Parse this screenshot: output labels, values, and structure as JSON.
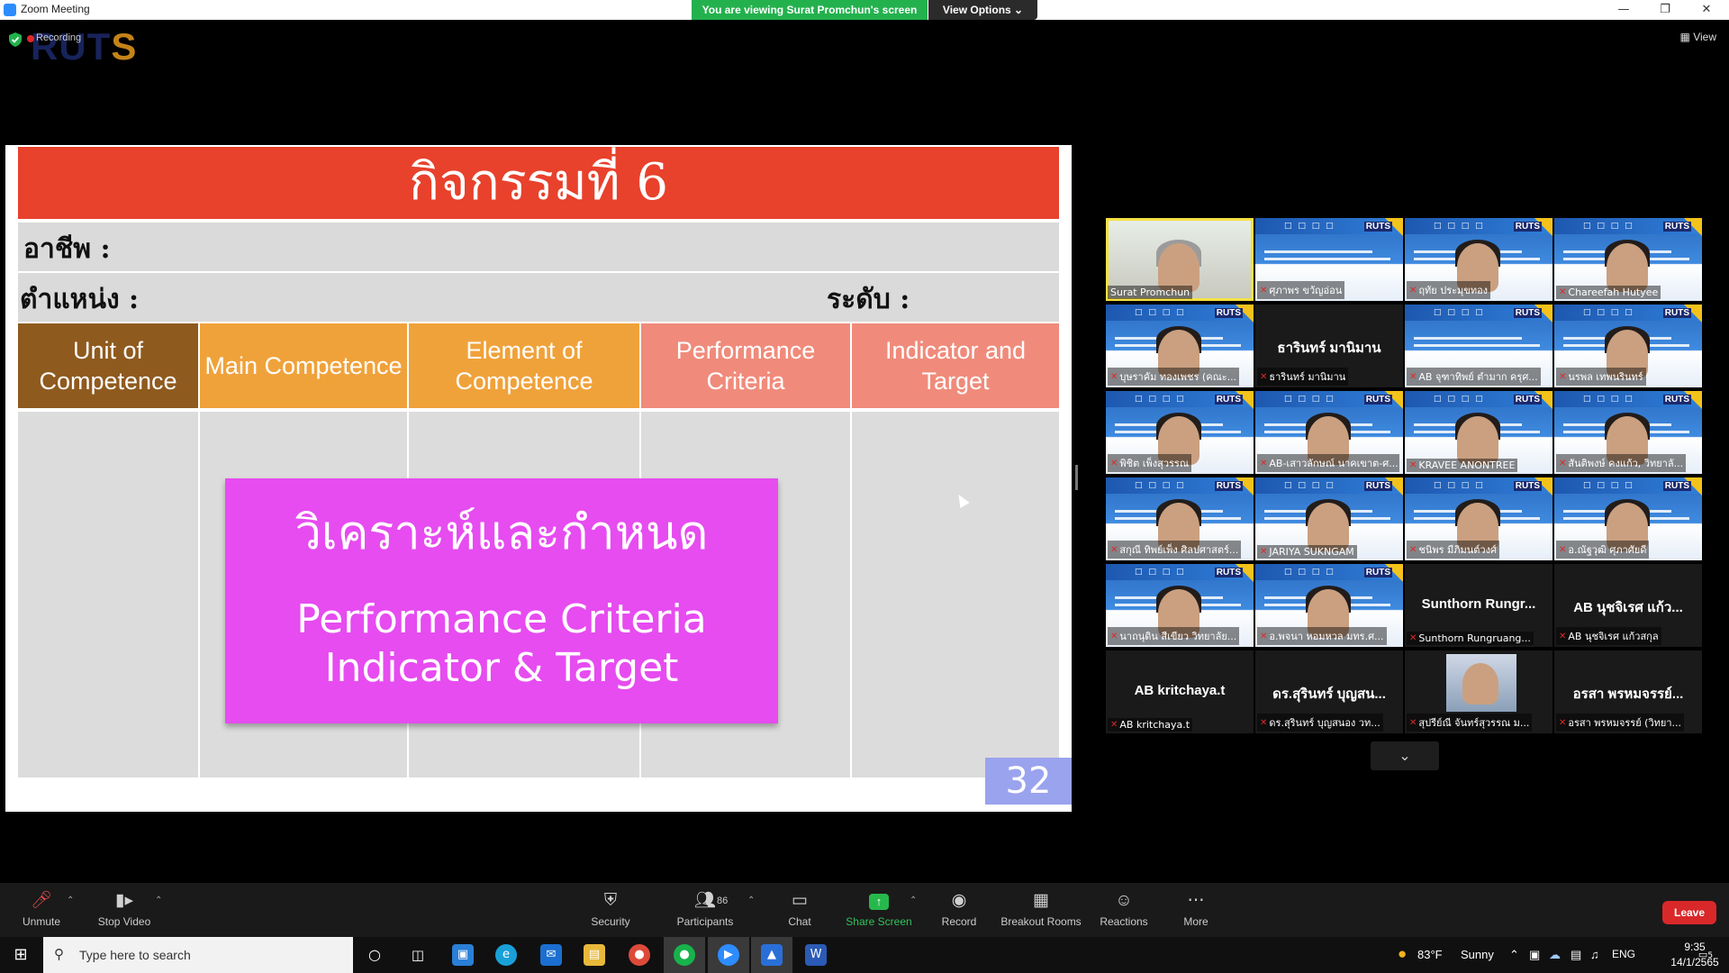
{
  "window": {
    "title": "Zoom Meeting",
    "share_banner": "You are viewing Surat Promchun's screen",
    "view_options": "View Options ⌄",
    "recording": "Recording",
    "logo": "RUTS",
    "view": "View"
  },
  "slide": {
    "header": "กิจกรรมที่ 6",
    "occupation_label": "อาชีพ :",
    "position_label": "ตำแหน่ง :",
    "level_label": "ระดับ :",
    "columns": [
      {
        "label": "Unit of Competence",
        "color": "#8f5a1e"
      },
      {
        "label": "Main Competence",
        "color": "#f0a23a"
      },
      {
        "label": "Element of Competence",
        "color": "#f0a23a"
      },
      {
        "label": "Performance Criteria",
        "color": "#f08b7b"
      },
      {
        "label": "Indicator and Target",
        "color": "#f08b7b"
      }
    ],
    "box_thai": "วิเคราะห์และกำหนด",
    "box_line1": "Performance Criteria",
    "box_line2": "Indicator & Target",
    "page_number": "32"
  },
  "gallery": {
    "tiles": [
      {
        "name": "Surat Promchun",
        "kind": "video-active"
      },
      {
        "name": "ศุภาพร ขวัญอ่อน",
        "kind": "poster"
      },
      {
        "name": "ฤทัย ประมุขทอง",
        "kind": "poster-person"
      },
      {
        "name": "Chareefah Hutyee",
        "kind": "poster-person"
      },
      {
        "name": "บุษราคัม ทองเพชร (คณะ...",
        "kind": "poster-person"
      },
      {
        "name": "ธารินทร์ มานิมาน",
        "kind": "name",
        "bigname": "ธารินทร์ มานิมาน"
      },
      {
        "name": "AB จุฑาทิพย์ ตำมาก ครุศ...",
        "kind": "poster"
      },
      {
        "name": "นรพล เทพนรินทร์",
        "kind": "poster-person"
      },
      {
        "name": "พิชิต เพ็งสุวรรณ",
        "kind": "poster-person"
      },
      {
        "name": "AB-เสาวลักษณ์ นาคเขาต-ศ...",
        "kind": "poster-person"
      },
      {
        "name": "KRAVEE ANONTREE",
        "kind": "poster-person"
      },
      {
        "name": "สันติพงษ์ คงแก้ว, วิทยาลั...",
        "kind": "poster-person"
      },
      {
        "name": "สกุณี ทิพย์เพ็ง ศิลปศาสตร์...",
        "kind": "poster-person"
      },
      {
        "name": "JARIYA SUKNGAM",
        "kind": "poster-person"
      },
      {
        "name": "ชนิพร มีภิมนต์วงศ์",
        "kind": "poster-person"
      },
      {
        "name": "อ.ณัฐวุฒิ ศุภาศัยดี",
        "kind": "poster-person"
      },
      {
        "name": "นาถนุดิน สีเขียว วิทยาลัย...",
        "kind": "poster-person"
      },
      {
        "name": "อ.พจนา หอมหวล มทร.ศ...",
        "kind": "poster-person"
      },
      {
        "name": "Sunthorn Rungruang...",
        "kind": "name",
        "bigname": "Sunthorn  Rungr..."
      },
      {
        "name": "AB นุชจิเรศ แก้วสกุล",
        "kind": "name",
        "bigname": "AB นุชจิเรศ แก้ว..."
      },
      {
        "name": "AB kritchaya.t",
        "kind": "name",
        "bigname": "AB kritchaya.t"
      },
      {
        "name": "ดร.สุรินทร์ บุญสนอง วท...",
        "kind": "name",
        "bigname": "ดร.สุรินทร์ บุญสน..."
      },
      {
        "name": "สุปรีย์ณี จันทร์สุวรรณ ม...",
        "kind": "photo"
      },
      {
        "name": "อรสา พรหมจรรย์ (วิทยา...",
        "kind": "name",
        "bigname": "อรสา พรหมจรรย์..."
      }
    ]
  },
  "toolbar": {
    "unmute": "Unmute",
    "stop_video": "Stop Video",
    "security": "Security",
    "participants": "Participants",
    "participant_count": "86",
    "chat": "Chat",
    "share_screen": "Share Screen",
    "record": "Record",
    "breakout_rooms": "Breakout Rooms",
    "reactions": "Reactions",
    "more": "More",
    "leave": "Leave"
  },
  "taskbar": {
    "search_placeholder": "Type here to search",
    "weather_temp": "83°F",
    "weather_text": "Sunny",
    "lang": "ENG",
    "time": "9:35",
    "date": "14/1/2565",
    "notif_count": "5"
  }
}
